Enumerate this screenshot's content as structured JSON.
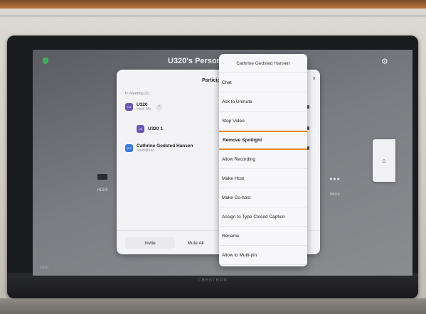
{
  "screen": {
    "title": "U320's Personal Meeting Room",
    "tile_hdmi": "HDMI",
    "tile_more": "More",
    "room_label": "U320"
  },
  "device": {
    "brand": "CRESTRON"
  },
  "panel": {
    "title": "Participants (3)",
    "close": "×",
    "section": "In Meeting (2)",
    "participants": [
      {
        "initials": "U3",
        "name": "U320",
        "sub": "Host, Me"
      },
      {
        "initials": "U3",
        "name": "U320 1",
        "sub": ""
      },
      {
        "initials": "CG",
        "name": "Cathrine Gedsted Hansen",
        "sub": "Spotlighted"
      }
    ],
    "invite_label": "Invite",
    "mute_all_label": "Mute All"
  },
  "menu": {
    "header": "Cathrine Gedsted Hansen",
    "items": [
      "Chat",
      "Ask to Unmute",
      "Stop Video",
      "Remove Spotlight",
      "Allow Recording",
      "Make Host",
      "Make Co-host",
      "Assign to Type Closed Caption",
      "Rename",
      "Allow to Multi-pin"
    ],
    "highlighted_index": 3
  },
  "colors": {
    "highlight": "#f08a24",
    "avatar_purple": "#6b55b5",
    "avatar_blue": "#3d7bd8",
    "shield_green": "#3fae5a"
  },
  "icons": [
    "shield-icon",
    "gear-icon",
    "hdmi-icon",
    "more-dots-icon",
    "close-icon",
    "chevron-icon",
    "home-icon"
  ]
}
